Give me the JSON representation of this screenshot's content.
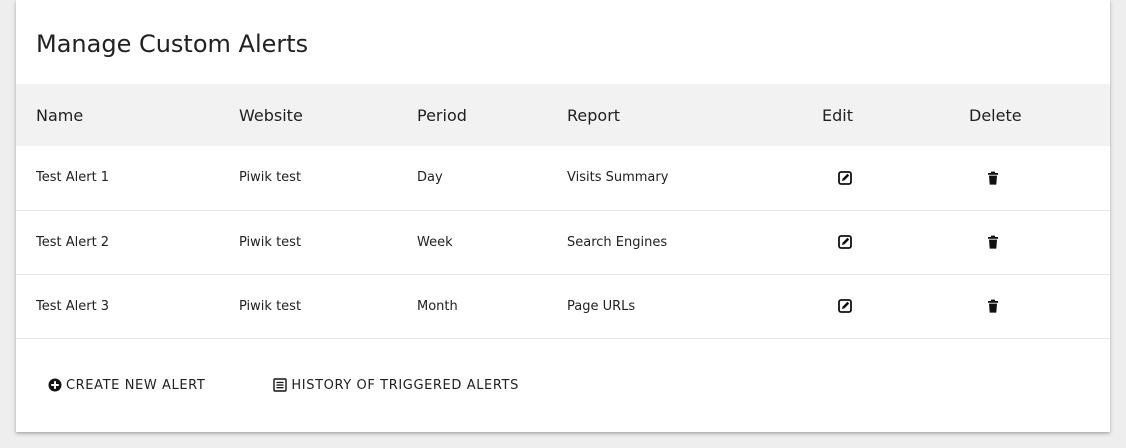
{
  "card": {
    "title": "Manage Custom Alerts"
  },
  "table": {
    "columns": {
      "name": "Name",
      "website": "Website",
      "period": "Period",
      "report": "Report",
      "edit": "Edit",
      "delete": "Delete"
    },
    "rows": [
      {
        "name": "Test Alert 1",
        "website": "Piwik test",
        "period": "Day",
        "report": "Visits Summary"
      },
      {
        "name": "Test Alert 2",
        "website": "Piwik test",
        "period": "Week",
        "report": "Search Engines"
      },
      {
        "name": "Test Alert 3",
        "website": "Piwik test",
        "period": "Month",
        "report": "Page URLs"
      }
    ]
  },
  "actions": {
    "create_label": "CREATE NEW ALERT",
    "create_icon": "plus-circle-icon",
    "history_label": "HISTORY OF TRIGGERED ALERTS",
    "history_icon": "list-icon"
  },
  "icons": {
    "edit": "edit-icon",
    "delete": "trash-icon"
  },
  "colors": {
    "background": "#eeeeee",
    "card": "#ffffff",
    "header_row": "#f2f2f2",
    "text": "#212121"
  }
}
